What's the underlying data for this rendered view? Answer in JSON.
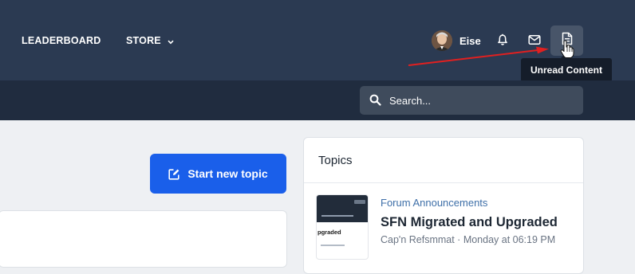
{
  "header": {
    "nav": [
      {
        "label": "LEADERBOARD"
      },
      {
        "label": "STORE"
      }
    ],
    "user": {
      "name": "Eise"
    },
    "icons": [
      "bell-icon",
      "envelope-icon",
      "unread-content-icon"
    ],
    "tooltip": "Unread Content"
  },
  "search": {
    "placeholder": "Search..."
  },
  "main": {
    "start_topic_label": "Start new topic"
  },
  "topics_widget": {
    "title": "Topics",
    "items": [
      {
        "forum": "Forum Announcements",
        "title": "SFN Migrated and Upgraded",
        "author": "Cap'n Refsmmat",
        "separator": " · ",
        "time": "Monday at 06:19 PM",
        "thumb_text": "pgraded"
      }
    ]
  },
  "colors": {
    "header_bg": "#2b3a52",
    "subbar_bg": "#202c3f",
    "accent": "#1a5fea",
    "link": "#3e6fa8",
    "annotation_arrow": "#e02020"
  }
}
